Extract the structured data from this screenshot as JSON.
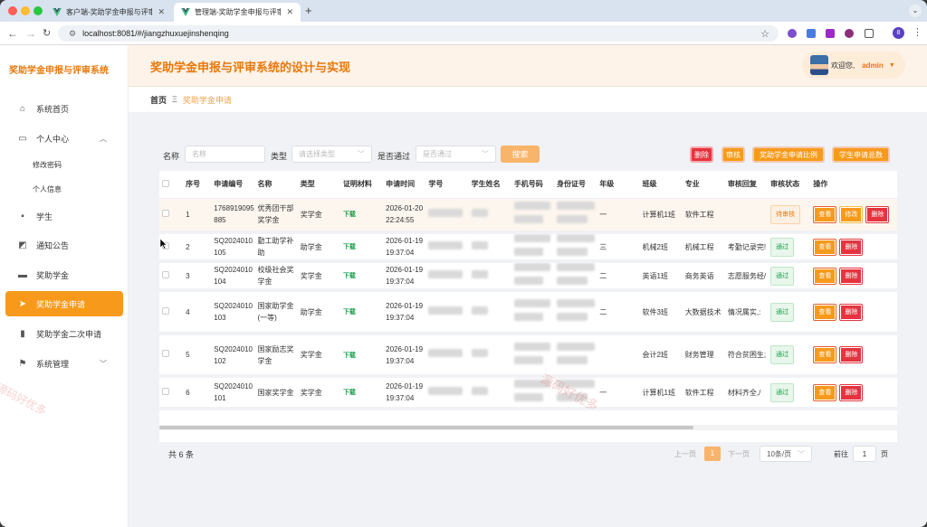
{
  "browser": {
    "tabs": [
      {
        "title": "客户端-奖助学金申报与评审系统",
        "active": false
      },
      {
        "title": "管理端-奖助学金申报与评审系统",
        "active": true
      }
    ],
    "new_tab": "+",
    "url": "localhost:8081/#/jiangzhuxuejinshenqing",
    "profile_initial": "8"
  },
  "sidebar": {
    "title": "奖助学金申报与评审系统",
    "items": [
      {
        "label": "系统首页",
        "icon": "home-icon"
      },
      {
        "label": "个人中心",
        "icon": "calendar-icon",
        "expanded": true
      },
      {
        "label": "修改密码",
        "sub": true
      },
      {
        "label": "个人信息",
        "sub": true
      },
      {
        "label": "学生",
        "icon": "chat-icon"
      },
      {
        "label": "通知公告",
        "icon": "chart-icon"
      },
      {
        "label": "奖助学金",
        "icon": "briefcase-icon"
      },
      {
        "label": "奖助学金申请",
        "icon": "send-icon",
        "active": true
      },
      {
        "label": "奖助学金二次申请",
        "icon": "bar-chart-icon"
      },
      {
        "label": "系统管理",
        "icon": "flag-icon"
      }
    ]
  },
  "header": {
    "title": "奖助学金申报与评审系统的设计与实现",
    "welcome": "欢迎您,",
    "username": "admin"
  },
  "breadcrumb": {
    "home": "首页",
    "sep": "Ξ",
    "current": "奖助学金申请"
  },
  "search": {
    "name_label": "名称",
    "name_placeholder": "名称",
    "type_label": "类型",
    "type_placeholder": "请选择类型",
    "pass_label": "是否通过",
    "pass_placeholder": "是否通过",
    "search_button": "搜索"
  },
  "toolbar": {
    "delete": "删除",
    "review": "审核",
    "ratio": "奖助学金申请比例",
    "total": "学生申请总数"
  },
  "table": {
    "columns": [
      "序号",
      "申请编号",
      "名称",
      "类型",
      "证明材料",
      "申请时间",
      "学号",
      "学生姓名",
      "手机号码",
      "身份证号",
      "年级",
      "班级",
      "专业",
      "审核回复",
      "审核状态",
      "操作"
    ],
    "download_label": "下载",
    "actions": {
      "view": "查看",
      "edit": "修改",
      "delete": "删除"
    },
    "rows": [
      {
        "index": "1",
        "app_no": "1768919095885",
        "name": "优秀团干部奖学金",
        "type": "奖学金",
        "time": "2026-01-20 22:24:55",
        "grade_suffix": "一",
        "class": "计算机1班",
        "major": "软件工程",
        "reply": "",
        "status": "待审核",
        "editable": true
      },
      {
        "index": "2",
        "app_no": "SQ2024010105",
        "name": "勤工助学补助",
        "type": "助学金",
        "time": "2026-01-19 19:37:04",
        "grade_suffix": "三",
        "class": "机械2班",
        "major": "机械工程",
        "reply": "考勤记录完!",
        "status": "通过",
        "editable": false
      },
      {
        "index": "3",
        "app_no": "SQ2024010104",
        "name": "校级社会奖学金",
        "type": "奖学金",
        "time": "2026-01-19 19:37:04",
        "grade_suffix": "二",
        "class": "英语1班",
        "major": "商务英语",
        "reply": "志愿服务经/",
        "status": "通过",
        "editable": false
      },
      {
        "index": "4",
        "app_no": "SQ2024010103",
        "name": "国家助学金(一等)",
        "type": "助学金",
        "time": "2026-01-19 19:37:04",
        "grade_suffix": "二",
        "class": "软件3班",
        "major": "大数据技术",
        "reply": "情况属实,:",
        "status": "通过",
        "editable": false
      },
      {
        "index": "5",
        "app_no": "SQ2024010102",
        "name": "国家励志奖学金",
        "type": "奖学金",
        "time": "2026-01-19 19:37:04",
        "grade_suffix": "",
        "class": "会计2班",
        "major": "财务管理",
        "reply": "符合贫困生;",
        "status": "通过",
        "editable": false
      },
      {
        "index": "6",
        "app_no": "SQ2024010101",
        "name": "国家奖学金",
        "type": "奖学金",
        "time": "2026-01-19 19:37:04",
        "grade_suffix": "一",
        "class": "计算机1班",
        "major": "软件工程",
        "reply": "材料齐全,/",
        "status": "通过",
        "editable": false
      }
    ]
  },
  "pagination": {
    "total": "共 6 条",
    "prev": "上一页",
    "current": "1",
    "next": "下一页",
    "page_size": "10条/页",
    "goto_label": "前往",
    "goto_value": "1",
    "page_suffix": "页"
  },
  "watermark": "源码好优多",
  "colors": {
    "accent": "#f79a1b",
    "title": "#e8780b",
    "danger": "#e5343f",
    "success": "#1a9f4b"
  }
}
